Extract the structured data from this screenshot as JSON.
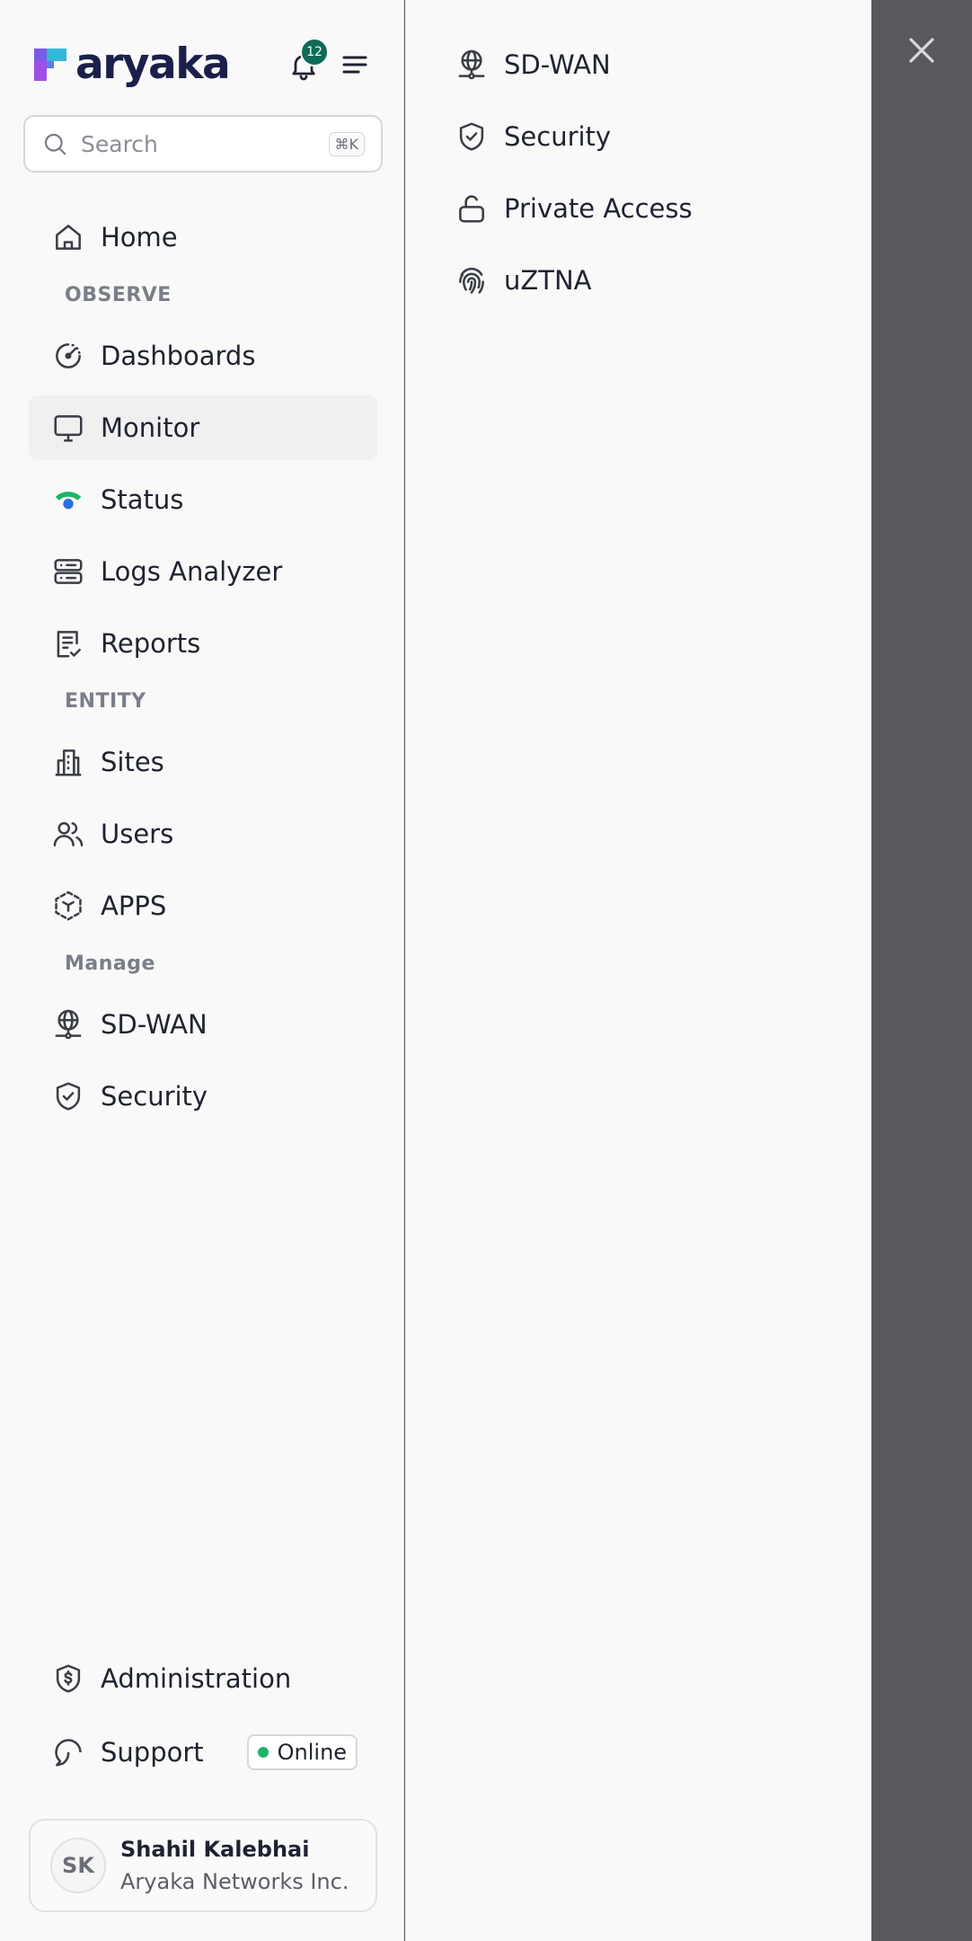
{
  "brand": {
    "name": "aryaka"
  },
  "header": {
    "notification_count": "12"
  },
  "search": {
    "placeholder": "Search",
    "shortcut": "⌘K"
  },
  "nav": {
    "home": "Home",
    "sections": {
      "observe": "OBSERVE",
      "entity": "ENTITY",
      "manage": "Manage"
    },
    "dashboards": "Dashboards",
    "monitor": "Monitor",
    "status": "Status",
    "logs": "Logs Analyzer",
    "reports": "Reports",
    "sites": "Sites",
    "users": "Users",
    "apps": "APPS",
    "sdwan": "SD-WAN",
    "security": "Security",
    "administration": "Administration",
    "support": "Support",
    "support_status": "Online"
  },
  "user": {
    "initials": "SK",
    "name": "Shahil Kalebhai",
    "org": "Aryaka Networks Inc."
  },
  "submenu": {
    "items": [
      {
        "label": "SD-WAN",
        "icon": "globe-network-icon"
      },
      {
        "label": "Security",
        "icon": "shield-check-icon"
      },
      {
        "label": "Private Access",
        "icon": "lock-open-icon"
      },
      {
        "label": "uZTNA",
        "icon": "fingerprint-icon"
      }
    ]
  },
  "colors": {
    "badge": "#0f6b5a",
    "online": "#1db36b",
    "overlay": "#58595d",
    "status_green": "#1db36b",
    "status_blue": "#2a6fe0"
  }
}
